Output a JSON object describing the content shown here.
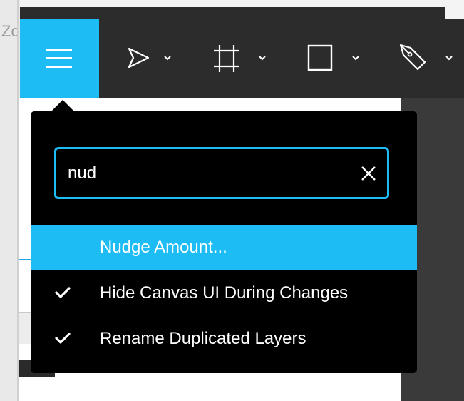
{
  "app": {
    "partial_title": "Zo"
  },
  "toolbar": {
    "menu_icon": "hamburger-icon",
    "tools": [
      {
        "icon": "pointer-arrow-icon",
        "dropdown_icon": "chevron-down-icon"
      },
      {
        "icon": "frame-icon",
        "dropdown_icon": "chevron-down-icon"
      },
      {
        "icon": "rectangle-icon",
        "dropdown_icon": "chevron-down-icon"
      },
      {
        "icon": "pen-icon",
        "dropdown_icon": "chevron-down-icon"
      }
    ]
  },
  "menu_popup": {
    "search": {
      "value": "nud",
      "placeholder": "",
      "clear_icon": "close-icon"
    },
    "items": [
      {
        "label": "Nudge Amount...",
        "checked": false,
        "highlighted": true
      },
      {
        "label": "Hide Canvas UI During Changes",
        "checked": true,
        "highlighted": false
      },
      {
        "label": "Rename Duplicated Layers",
        "checked": true,
        "highlighted": false
      }
    ]
  },
  "colors": {
    "accent": "#1ebcf5",
    "toolbar_bg": "#2c2c2c",
    "popup_bg": "#000000",
    "text": "#ffffff"
  }
}
